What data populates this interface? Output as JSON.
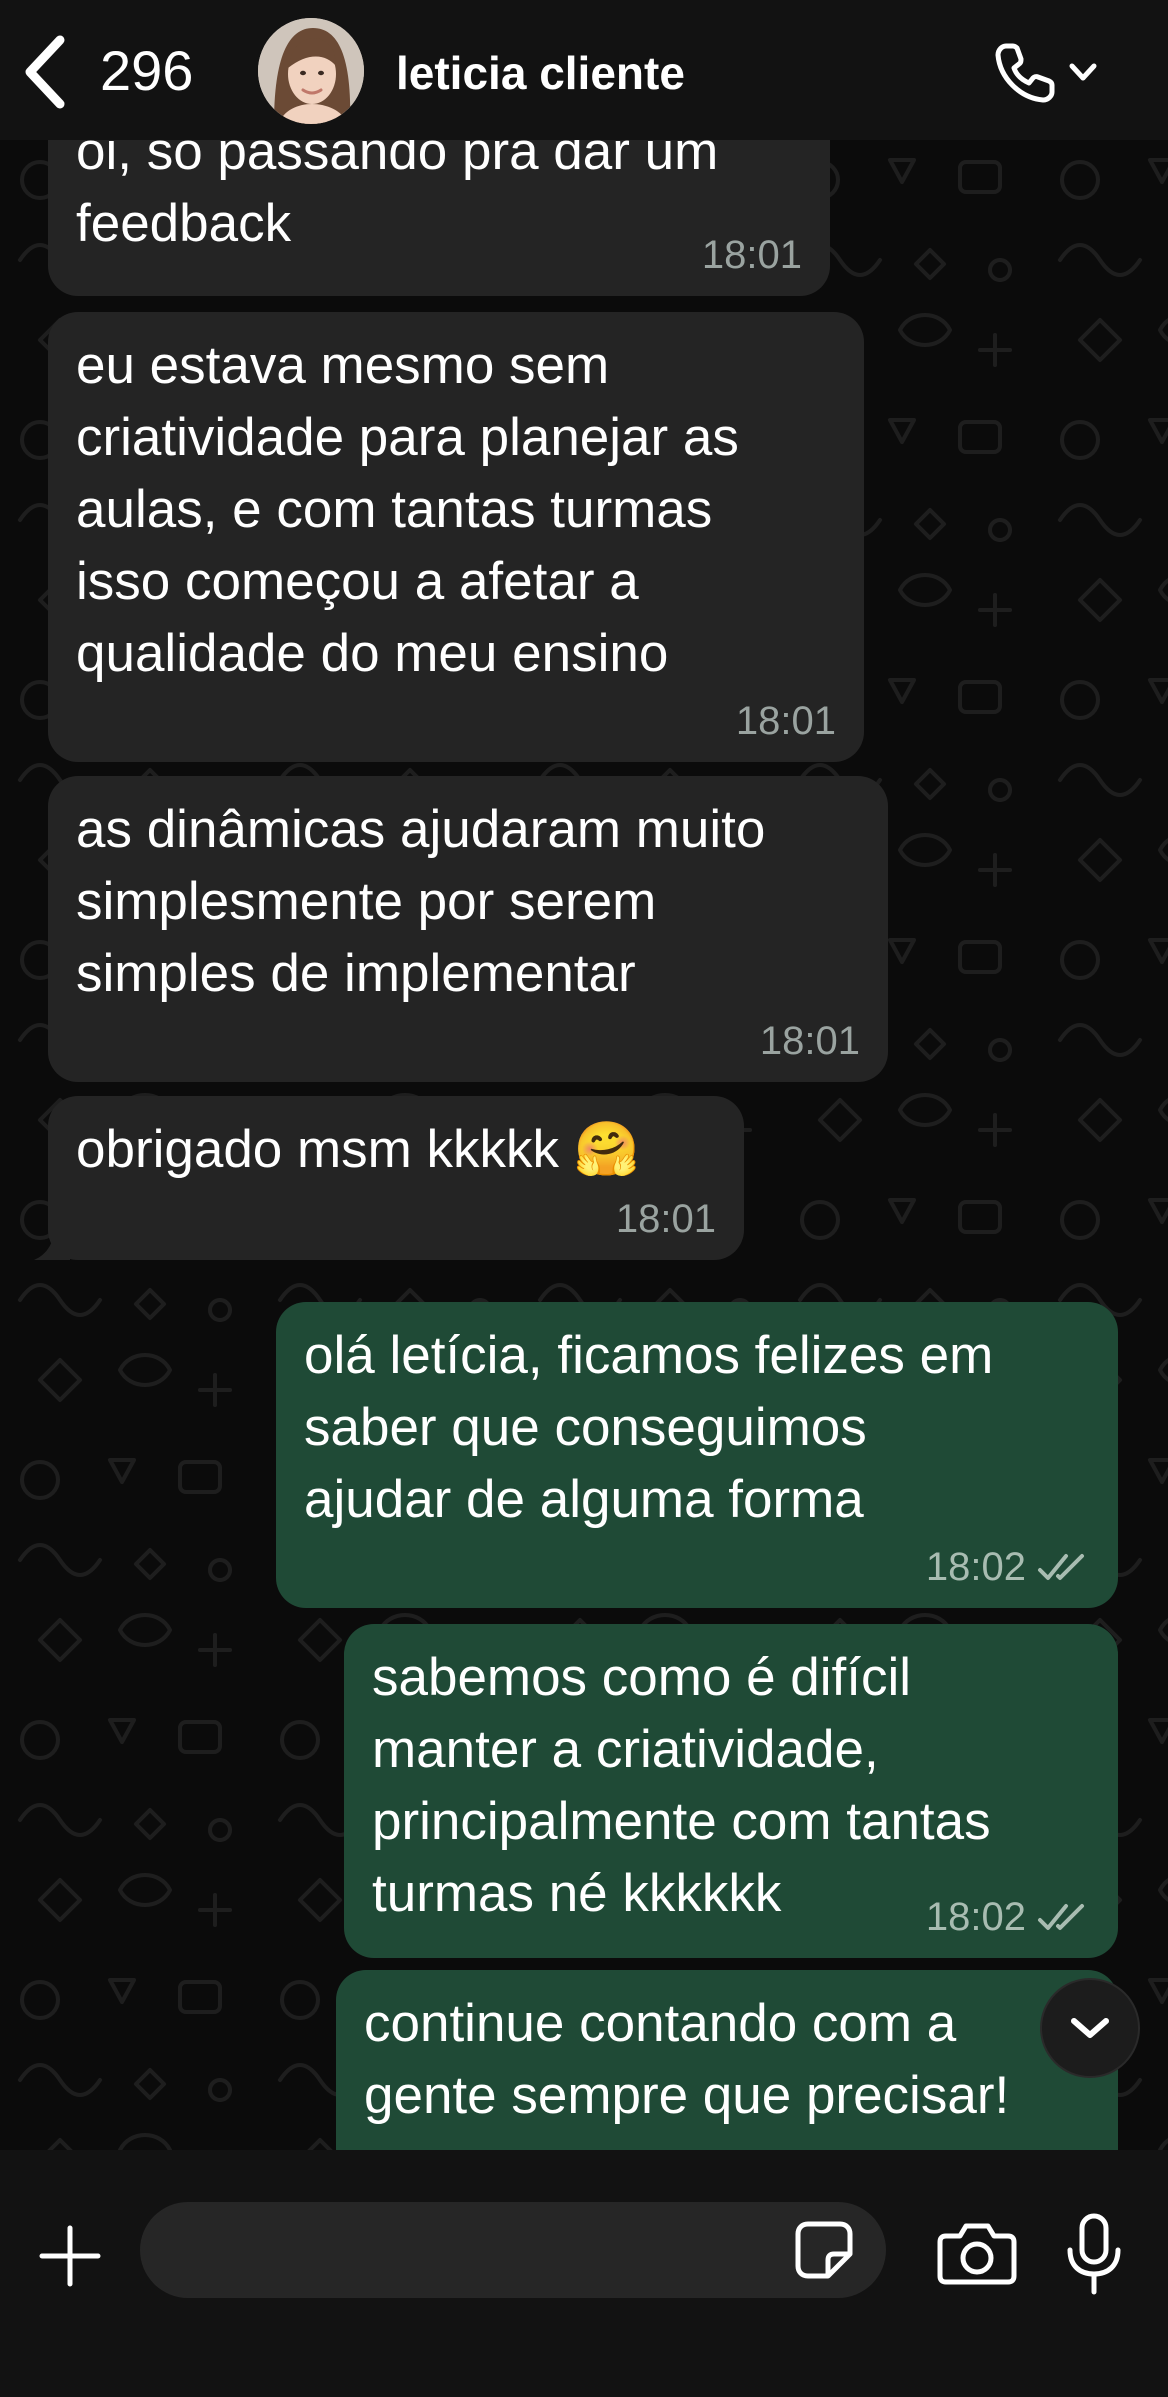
{
  "header": {
    "back_count": "296",
    "contact_name": "leticia cliente",
    "icons": [
      "chevron-left-icon",
      "phone-icon",
      "chevron-down-icon"
    ]
  },
  "messages": [
    {
      "direction": "incoming",
      "text": "oi, só passando pra dar um\nfeedback",
      "time": "18:01"
    },
    {
      "direction": "incoming",
      "text": "eu estava mesmo sem\ncriatividade para planejar as\naulas, e com tantas turmas\nisso começou a afetar a\nqualidade do meu ensino",
      "time": "18:01"
    },
    {
      "direction": "incoming",
      "text": "as dinâmicas ajudaram muito\nsimplesmente por serem\nsimples de implementar",
      "time": "18:01"
    },
    {
      "direction": "incoming",
      "text": "obrigado msm kkkkk 🤗",
      "time": "18:01"
    },
    {
      "direction": "outgoing",
      "text": "olá letícia, ficamos felizes em\nsaber que conseguimos\najudar de alguma forma",
      "time": "18:02",
      "status": "read"
    },
    {
      "direction": "outgoing",
      "text": "sabemos como é difícil\nmanter a criatividade,\nprincipalmente com tantas\nturmas né kkkkkk",
      "time": "18:02",
      "status": "read"
    },
    {
      "direction": "outgoing",
      "text": "continue contando com a\ngente sempre que precisar!",
      "time": "",
      "status": "read"
    }
  ],
  "input_bar": {
    "placeholder": "",
    "icons": [
      "plus-icon",
      "sticker-icon",
      "camera-icon",
      "microphone-icon"
    ]
  },
  "colors": {
    "incoming_bubble": "#242424",
    "outgoing_bubble": "#1f4a36",
    "background": "#0b0b0b",
    "read_ticks": "#a8bcb1"
  }
}
